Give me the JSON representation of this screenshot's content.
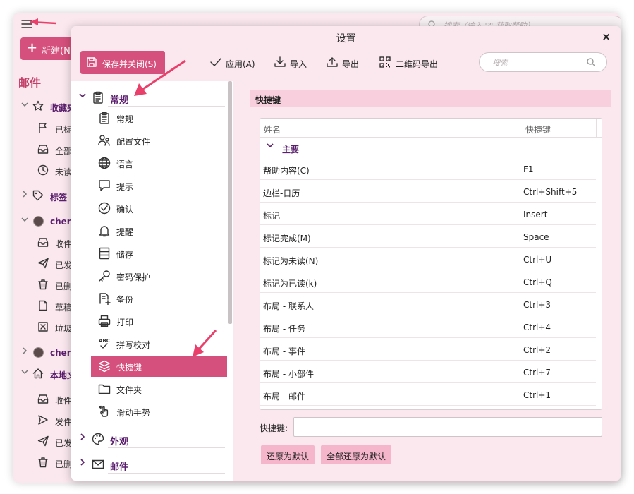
{
  "background": {
    "search_placeholder": "搜索（输入 '?' 获取帮助）",
    "new_button": "新建(N)",
    "section_title": "邮件",
    "items": [
      {
        "label": "收藏夹",
        "kind": "group"
      },
      {
        "label": "已标",
        "kind": "item",
        "icon": "flag-icon"
      },
      {
        "label": "全部",
        "kind": "item",
        "icon": "inbox-icon"
      },
      {
        "label": "未读",
        "kind": "item",
        "icon": "clock-icon"
      },
      {
        "label": "标签",
        "kind": "group"
      },
      {
        "label": "chen",
        "kind": "account"
      },
      {
        "label": "收件",
        "kind": "item",
        "icon": "inbox-icon"
      },
      {
        "label": "已发",
        "kind": "item",
        "icon": "send-icon"
      },
      {
        "label": "已删",
        "kind": "item",
        "icon": "trash-icon"
      },
      {
        "label": "草稿",
        "kind": "item",
        "icon": "draft-icon"
      },
      {
        "label": "垃圾",
        "kind": "item",
        "icon": "junk-icon"
      },
      {
        "label": "chen",
        "kind": "account"
      },
      {
        "label": "本地文",
        "kind": "group"
      },
      {
        "label": "收件",
        "kind": "item",
        "icon": "inbox-icon"
      },
      {
        "label": "发件",
        "kind": "item",
        "icon": "outbox-icon"
      },
      {
        "label": "已发",
        "kind": "item",
        "icon": "send-icon"
      },
      {
        "label": "已删",
        "kind": "item",
        "icon": "trash-icon"
      }
    ]
  },
  "dialog": {
    "title": "设置",
    "close": "×",
    "toolbar": {
      "save_close": "保存并关闭(S)",
      "apply": "应用(A)",
      "import": "导入",
      "export": "导出",
      "qr_export": "二维码导出",
      "search_placeholder": "搜索"
    },
    "tree": {
      "groups": [
        {
          "label": "常规",
          "expanded": true,
          "icon": "clipboard-icon"
        },
        {
          "label": "外观",
          "expanded": false,
          "icon": "palette-icon"
        },
        {
          "label": "邮件",
          "expanded": false,
          "icon": "mail-icon"
        }
      ],
      "items": [
        {
          "label": "常规",
          "icon": "clipboard-icon"
        },
        {
          "label": "配置文件",
          "icon": "profiles-icon"
        },
        {
          "label": "语言",
          "icon": "globe-icon"
        },
        {
          "label": "提示",
          "icon": "chat-icon"
        },
        {
          "label": "确认",
          "icon": "check-circle-icon"
        },
        {
          "label": "提醒",
          "icon": "bell-icon"
        },
        {
          "label": "储存",
          "icon": "storage-icon"
        },
        {
          "label": "密码保护",
          "icon": "key-icon"
        },
        {
          "label": "备份",
          "icon": "backup-icon"
        },
        {
          "label": "打印",
          "icon": "printer-icon"
        },
        {
          "label": "拼写校对",
          "icon": "spellcheck-icon"
        },
        {
          "label": "快捷键",
          "icon": "shortcut-icon",
          "active": true
        },
        {
          "label": "文件夹",
          "icon": "folder-icon"
        },
        {
          "label": "滑动手势",
          "icon": "gesture-icon"
        }
      ]
    },
    "content": {
      "section_title": "快捷键",
      "columns": [
        "姓名",
        "快捷键"
      ],
      "group_label": "主要",
      "rows": [
        {
          "name": "帮助内容(C)",
          "key": "F1"
        },
        {
          "name": "边栏-日历",
          "key": "Ctrl+Shift+5"
        },
        {
          "name": "标记",
          "key": "Insert"
        },
        {
          "name": "标记完成(M)",
          "key": "Space"
        },
        {
          "name": "标记为未读(N)",
          "key": "Ctrl+U"
        },
        {
          "name": "标记为已读(k)",
          "key": "Ctrl+Q"
        },
        {
          "name": "布局 - 联系人",
          "key": "Ctrl+3"
        },
        {
          "name": "布局 - 任务",
          "key": "Ctrl+4"
        },
        {
          "name": "布局 - 事件",
          "key": "Ctrl+2"
        },
        {
          "name": "布局 - 小部件",
          "key": "Ctrl+7"
        },
        {
          "name": "布局 - 邮件",
          "key": "Ctrl+1"
        }
      ],
      "shortcut_label": "快捷键:",
      "shortcut_value": "",
      "reset_default": "还原为默认",
      "reset_all_default": "全部还原为默认"
    }
  },
  "colors": {
    "accent": "#d5507c",
    "panel_bg": "#fae8ee",
    "section_header": "#f7cfdd",
    "button_pink": "#f5b5ca",
    "group_text": "#5b1f6e",
    "annotation_arrow": "#e8406a"
  }
}
